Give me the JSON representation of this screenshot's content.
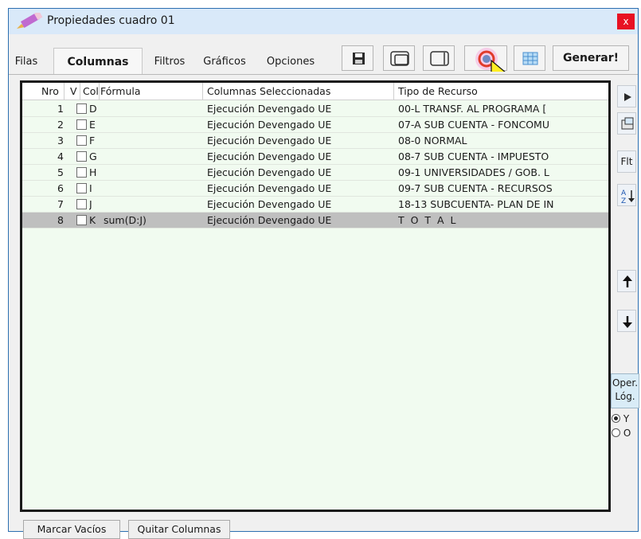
{
  "window": {
    "title": "Propiedades cuadro 01",
    "close_label": "x"
  },
  "tabs": [
    "Filas",
    "Columnas",
    "Filtros",
    "Gráficos",
    "Opciones"
  ],
  "active_tab": "Columnas",
  "toolbar": {
    "generate_label": "Generar!"
  },
  "grid": {
    "headers": [
      "Nro",
      "V",
      "Col",
      "Fórmula",
      "Columnas Seleccionadas",
      "Tipo de Recurso"
    ],
    "rows": [
      {
        "nro": "1",
        "col": "D",
        "formula": "",
        "selected_column": "Ejecución Devengado UE",
        "resource_type": "00-L   TRANSF. AL PROGRAMA ["
      },
      {
        "nro": "2",
        "col": "E",
        "formula": "",
        "selected_column": "Ejecución Devengado UE",
        "resource_type": "07-A   SUB CUENTA - FONCOMU"
      },
      {
        "nro": "3",
        "col": "F",
        "formula": "",
        "selected_column": "Ejecución Devengado UE",
        "resource_type": "08-0   NORMAL"
      },
      {
        "nro": "4",
        "col": "G",
        "formula": "",
        "selected_column": "Ejecución Devengado UE",
        "resource_type": "08-7   SUB CUENTA - IMPUESTO"
      },
      {
        "nro": "5",
        "col": "H",
        "formula": "",
        "selected_column": "Ejecución Devengado UE",
        "resource_type": "09-1   UNIVERSIDADES / GOB. L"
      },
      {
        "nro": "6",
        "col": "I",
        "formula": "",
        "selected_column": "Ejecución Devengado UE",
        "resource_type": "09-7   SUB CUENTA - RECURSOS"
      },
      {
        "nro": "7",
        "col": "J",
        "formula": "",
        "selected_column": "Ejecución Devengado UE",
        "resource_type": "18-13  SUBCUENTA- PLAN DE IN"
      },
      {
        "nro": "8",
        "col": "K",
        "formula": "sum(D:J)",
        "selected_column": "Ejecución Devengado UE",
        "resource_type": "T O T A L"
      }
    ]
  },
  "side": {
    "filter_label": "Flt",
    "oper_label_1": "Oper.",
    "oper_label_2": "Lóg.",
    "radio_y": "Y",
    "radio_o": "O",
    "selected_radio": "Y"
  },
  "bottom": {
    "mark_empty_label": "Marcar Vacíos",
    "remove_columns_label": "Quitar Columnas"
  }
}
